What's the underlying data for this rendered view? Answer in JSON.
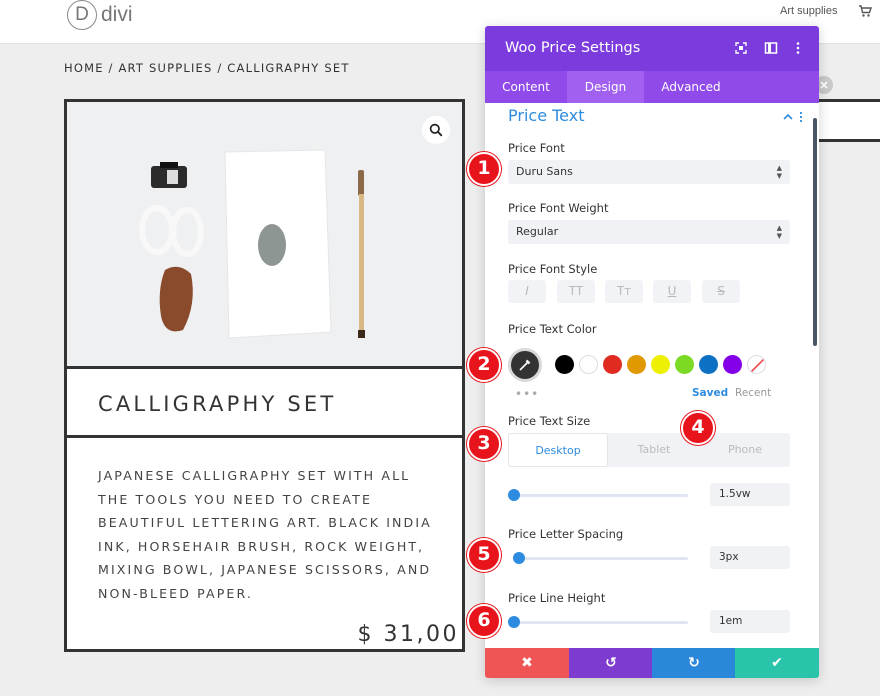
{
  "site": {
    "logo_letter": "D",
    "logo_text": "divi",
    "nav_link": "Art supplies",
    "cart_icon": "cart-icon"
  },
  "breadcrumb": "HOME / ART SUPPLIES / CALLIGRAPHY SET",
  "product": {
    "title": "CALLIGRAPHY SET",
    "description": "JAPANESE CALLIGRAPHY SET WITH ALL THE TOOLS YOU NEED TO CREATE BEAUTIFUL LETTERING ART.  BLACK INDIA INK, HORSEHAIR BRUSH, ROCK WEIGHT, MIXING BOWL, JAPANESE SCISSORS, AND NON-BLEED PAPER.",
    "price": "$ 31,00",
    "zoom_icon": "magnifier-icon"
  },
  "panel": {
    "title": "Woo Price Settings",
    "tabs": [
      {
        "label": "Content",
        "active": false
      },
      {
        "label": "Design",
        "active": true
      },
      {
        "label": "Advanced",
        "active": false
      }
    ],
    "section_title": "Price Text",
    "price_font": {
      "label": "Price Font",
      "value": "Duru Sans"
    },
    "price_font_weight": {
      "label": "Price Font Weight",
      "value": "Regular"
    },
    "price_font_style": {
      "label": "Price Font Style",
      "buttons": [
        "I",
        "TT",
        "Tт",
        "U",
        "S"
      ]
    },
    "price_text_color": {
      "label": "Price Text Color",
      "swatches": [
        "#000000",
        "#ffffff",
        "#e02b20",
        "#e09900",
        "#edf000",
        "#7cda24",
        "#0c71c3",
        "#8300e9"
      ],
      "saved_label": "Saved",
      "recent_label": "Recent",
      "more": "•••"
    },
    "price_text_size": {
      "label": "Price Text Size",
      "devices": [
        {
          "label": "Desktop",
          "active": true
        },
        {
          "label": "Tablet",
          "active": false
        },
        {
          "label": "Phone",
          "active": false
        }
      ],
      "value": "1.5vw",
      "slider_fraction": 0
    },
    "price_letter_spacing": {
      "label": "Price Letter Spacing",
      "value": "3px",
      "slider_fraction": 0.03
    },
    "price_line_height": {
      "label": "Price Line Height",
      "value": "1em",
      "slider_fraction": 0
    },
    "footer_buttons": [
      {
        "name": "discard",
        "glyph": "✖",
        "color": "#ef5555"
      },
      {
        "name": "undo",
        "glyph": "↺",
        "color": "#7e3bd0"
      },
      {
        "name": "redo",
        "glyph": "↻",
        "color": "#2b87da"
      },
      {
        "name": "save",
        "glyph": "✔",
        "color": "#29c4a9"
      }
    ],
    "accent": "#7c3bdc"
  },
  "annotations": [
    "1",
    "2",
    "3",
    "4",
    "5",
    "6"
  ]
}
